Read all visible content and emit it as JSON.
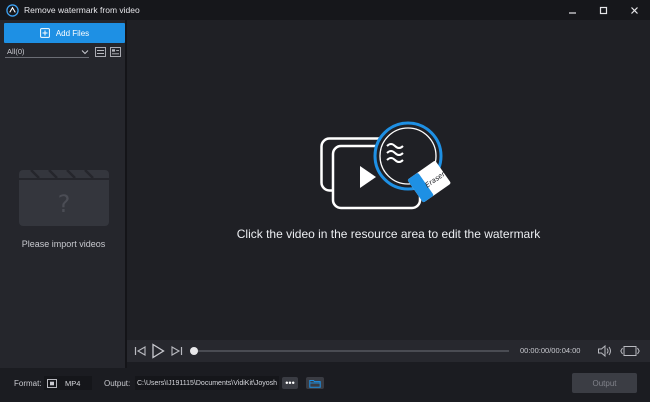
{
  "window": {
    "title": "Remove watermark from video",
    "icons": [
      "app-logo-icon",
      "minimize-icon",
      "maximize-icon",
      "close-icon"
    ]
  },
  "sidebar": {
    "add_files_label": "Add Files",
    "filter_value": "All(0)",
    "empty_text": "Please import videos",
    "icons": [
      "plus-box-icon",
      "chevron-down-icon",
      "list-view-icon",
      "grid-view-icon",
      "film-placeholder-icon"
    ]
  },
  "preview": {
    "hint": "Click the video in the resource area to edit the watermark",
    "eraser_label": "Eraser"
  },
  "player": {
    "time": "00:00:00/00:04:00",
    "progress": 0,
    "icons": [
      "skip-back-icon",
      "play-icon",
      "skip-forward-icon",
      "volume-icon",
      "screen-ratio-icon"
    ]
  },
  "bottom": {
    "format_label": "Format:",
    "format_value": "MP4",
    "output_label": "Output:",
    "output_path": "C:\\Users\\IJ191115\\Documents\\VidiKit\\Joyosh",
    "more_label": "•••",
    "output_button": "Output",
    "icons": [
      "format-settings-icon",
      "folder-icon"
    ]
  },
  "colors": {
    "accent": "#1e90e4",
    "background": "#1b1c21",
    "panel": "#25262c"
  }
}
